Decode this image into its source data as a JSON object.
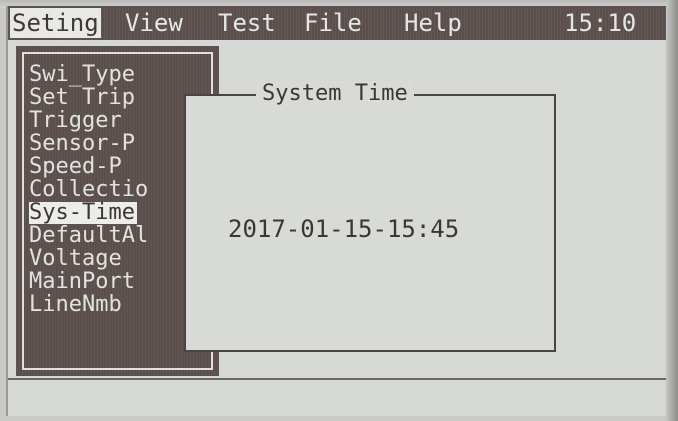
{
  "menubar": {
    "items": [
      {
        "label": "Seting",
        "selected": true
      },
      {
        "label": "View",
        "selected": false
      },
      {
        "label": "Test",
        "selected": false
      },
      {
        "label": "File",
        "selected": false
      },
      {
        "label": "Help",
        "selected": false
      }
    ],
    "clock": "15:10"
  },
  "dropdown": {
    "items": [
      {
        "label": "Swi_Type"
      },
      {
        "label": "Set Trip"
      },
      {
        "label": "Trigger"
      },
      {
        "label": "Sensor-P"
      },
      {
        "label": "Speed-P"
      },
      {
        "label": "Collectio"
      },
      {
        "label": "Sys-Time",
        "selected": true
      },
      {
        "label": "DefaultAl"
      },
      {
        "label": "Voltage"
      },
      {
        "label": "MainPort"
      },
      {
        "label": "LineNmb"
      }
    ]
  },
  "dialog": {
    "title": "System Time",
    "value": "2017-01-15-15:45"
  },
  "colors": {
    "menu_bg": "#5b4f4c",
    "screen_bg": "#d6d8d6",
    "text_dark": "#3b3634",
    "text_light": "#e6e6e6"
  }
}
